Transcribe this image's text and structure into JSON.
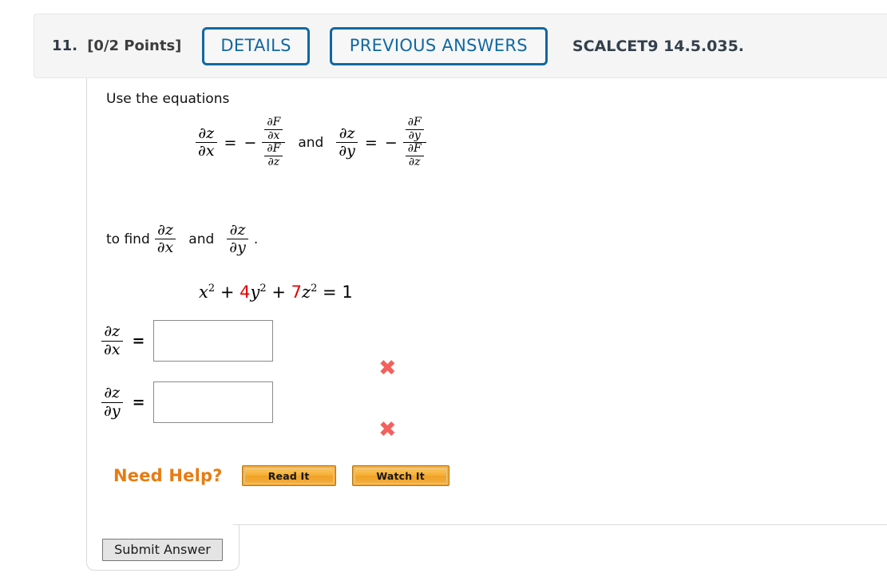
{
  "header": {
    "number": "11.",
    "points": "[0/2 Points]",
    "details_label": "DETAILS",
    "previous_answers_label": "PREVIOUS ANSWERS",
    "code": "SCALCET9 14.5.035.",
    "accent_blue": "#1168a0",
    "background": "#f5f5f5"
  },
  "problem": {
    "intro": "Use the equations",
    "equations": {
      "lhs1_num": "∂z",
      "lhs1_den": "∂x",
      "equals": "=",
      "minus": "−",
      "rhs1_top_num": "∂F",
      "rhs1_top_den": "∂x",
      "rhs1_bot_num": "∂F",
      "rhs1_bot_den": "∂z",
      "conjunction": "and",
      "lhs2_num": "∂z",
      "lhs2_den": "∂y",
      "rhs2_top_num": "∂F",
      "rhs2_top_den": "∂y",
      "rhs2_bot_num": "∂F",
      "rhs2_bot_den": "∂z"
    },
    "to_find_prefix": "to find",
    "to_find_1_num": "∂z",
    "to_find_1_den": "∂x",
    "to_find_conjunction": "and",
    "to_find_2_num": "∂z",
    "to_find_2_den": "∂y",
    "to_find_period": ".",
    "surface": {
      "term1_var": "x",
      "term1_exp": "2",
      "plus1": "+",
      "term2_coef": "4",
      "term2_var": "y",
      "term2_exp": "2",
      "plus2": "+",
      "term3_coef": "7",
      "term3_var": "z",
      "term3_exp": "2",
      "equals": "=",
      "rhs": "1",
      "highlight_color": "#e50000"
    }
  },
  "answers": [
    {
      "label_num": "∂z",
      "label_den": "∂x",
      "equals": "=",
      "value": "",
      "placeholder": "",
      "status_icon": "✖",
      "status": "incorrect",
      "status_color": "#f4615c"
    },
    {
      "label_num": "∂z",
      "label_den": "∂y",
      "equals": "=",
      "value": "",
      "placeholder": "",
      "status_icon": "✖",
      "status": "incorrect",
      "status_color": "#f4615c"
    }
  ],
  "need_help": {
    "label": "Need Help?",
    "label_color": "#e87b11",
    "read_it_label": "Read It",
    "watch_it_label": "Watch It"
  },
  "footer": {
    "submit_label": "Submit Answer"
  }
}
